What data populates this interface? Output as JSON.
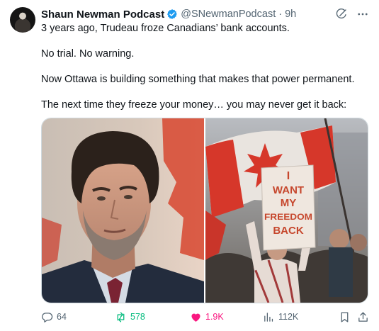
{
  "author": {
    "name": "Shaun Newman Podcast",
    "handle": "@SNewmanPodcast",
    "separator": "·",
    "time": "9h"
  },
  "tweet": {
    "paragraphs": [
      "3 years ago, Trudeau froze Canadians’ bank accounts.",
      "No trial. No warning.",
      "Now Ottawa is building something that makes that power permanent.",
      "The next time they freeze your money… you may never get it back:"
    ]
  },
  "media": {
    "sign_lines": [
      "I",
      "WANT",
      "MY",
      "FREEDOM",
      "BACK"
    ]
  },
  "actions": {
    "replies": "64",
    "reposts": "578",
    "likes": "1.9K",
    "views": "112K"
  },
  "colors": {
    "text": "#0f1419",
    "muted": "#536471",
    "verified": "#1d9bf0",
    "repost": "#00ba7c",
    "like": "#f91880"
  },
  "icons": [
    "verified-icon",
    "grok-icon",
    "more-icon",
    "reply-icon",
    "repost-icon",
    "like-icon",
    "views-icon",
    "bookmark-icon",
    "share-icon"
  ]
}
